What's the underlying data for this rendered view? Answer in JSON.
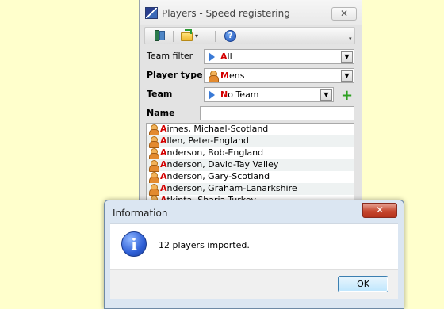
{
  "window": {
    "title": "Players - Speed registering",
    "close_label": "✕",
    "toolbar": {
      "folder_dropdown_label": "▾",
      "help_label": "?",
      "overflow_label": "▾"
    },
    "filters": {
      "team_filter": {
        "label": "Team filter",
        "first": "A",
        "rest": "ll"
      },
      "player_type": {
        "label": "Player type",
        "first": "M",
        "rest": "ens"
      },
      "team": {
        "label": "Team",
        "first": "N",
        "rest": "o Team",
        "add_label": "+"
      },
      "name": {
        "label": "Name",
        "value": ""
      }
    },
    "dropdown_arrow": "▼",
    "players": [
      {
        "first": "A",
        "rest": "irnes, Michael-Scotland"
      },
      {
        "first": "A",
        "rest": "llen, Peter-England"
      },
      {
        "first": "A",
        "rest": "nderson, Bob-England"
      },
      {
        "first": "A",
        "rest": "nderson, David-Tay Valley"
      },
      {
        "first": "A",
        "rest": "nderson, Gary-Scotland"
      },
      {
        "first": "A",
        "rest": "nderson, Graham-Lanarkshire"
      },
      {
        "first": "A",
        "rest": "tkinta, Sharia-Turkey"
      }
    ]
  },
  "dialog": {
    "title": "Information",
    "close_label": "✕",
    "icon_label": "i",
    "message": "12 players imported.",
    "ok_label": "OK"
  },
  "colors": {
    "background": "#ffffcc",
    "first_letter": "#d40000",
    "dialog_frame": "#dbe6f2",
    "close_red": "#c6472f"
  }
}
